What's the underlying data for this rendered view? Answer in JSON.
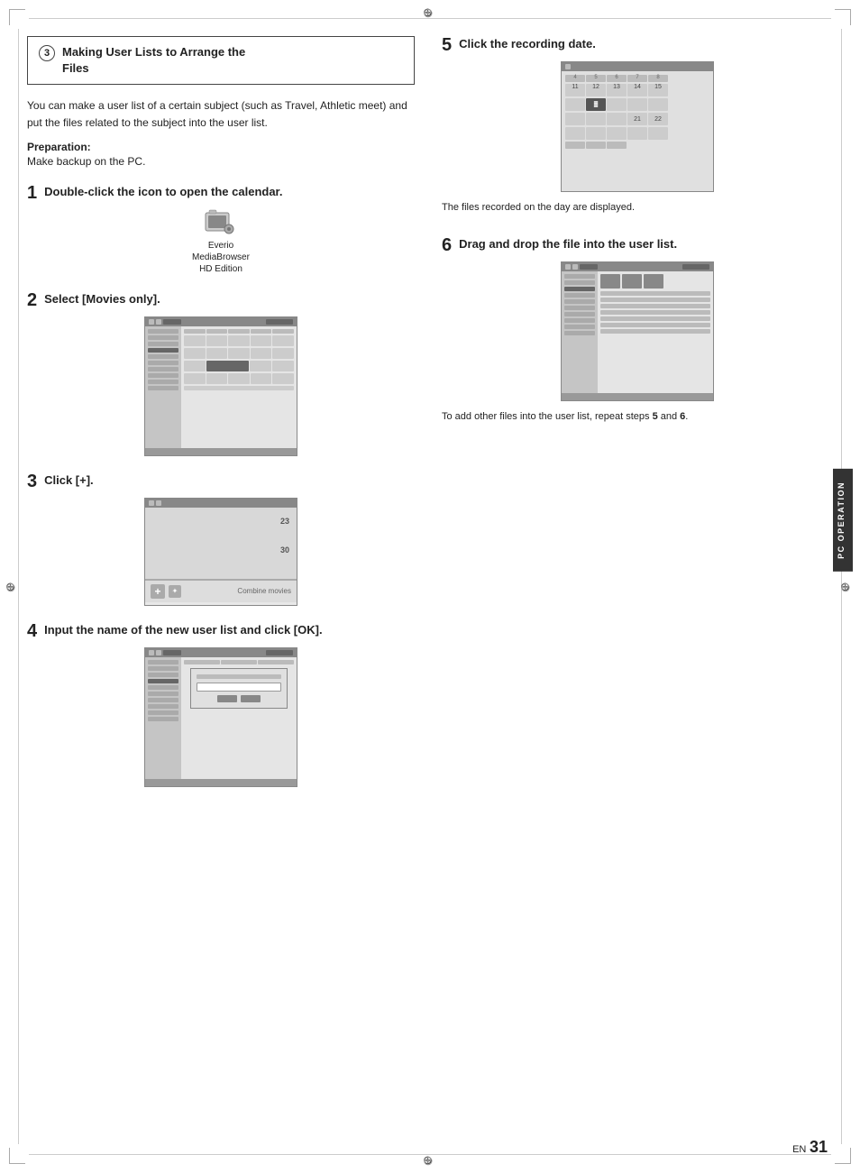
{
  "page": {
    "title_box": {
      "circle": "3",
      "title_line1": "Making User Lists to Arrange the",
      "title_line2": "Files"
    },
    "intro": "You can make a user list of a certain subject (such as Travel, Athletic meet) and put the files related to the subject into the user list.",
    "prep_label": "Preparation:",
    "prep_text": "Make backup on the PC.",
    "steps": [
      {
        "num": "1",
        "title": "Double-click the icon to open the calendar.",
        "image_desc": "Everio MediaBrowser HD Edition icon"
      },
      {
        "num": "2",
        "title": "Select [Movies only].",
        "image_desc": "Screenshot of movie selection"
      },
      {
        "num": "3",
        "title": "Click [+].",
        "image_desc": "Screenshot showing + button"
      },
      {
        "num": "4",
        "title": "Input the name of the new user list and click [OK].",
        "image_desc": "Screenshot of input dialog"
      }
    ],
    "right_steps": [
      {
        "num": "5",
        "title": "Click the recording date.",
        "caption": "The files recorded on the day are displayed.",
        "image_desc": "Calendar screenshot"
      },
      {
        "num": "6",
        "title": "Drag and drop the file into the user list.",
        "caption": "To add other files into the user list, repeat steps 5 and 6.",
        "image_desc": "Drag drop screenshot"
      }
    ],
    "sidebar_label": "PC OPERATION",
    "page_number": {
      "en": "EN",
      "num": "31"
    }
  }
}
